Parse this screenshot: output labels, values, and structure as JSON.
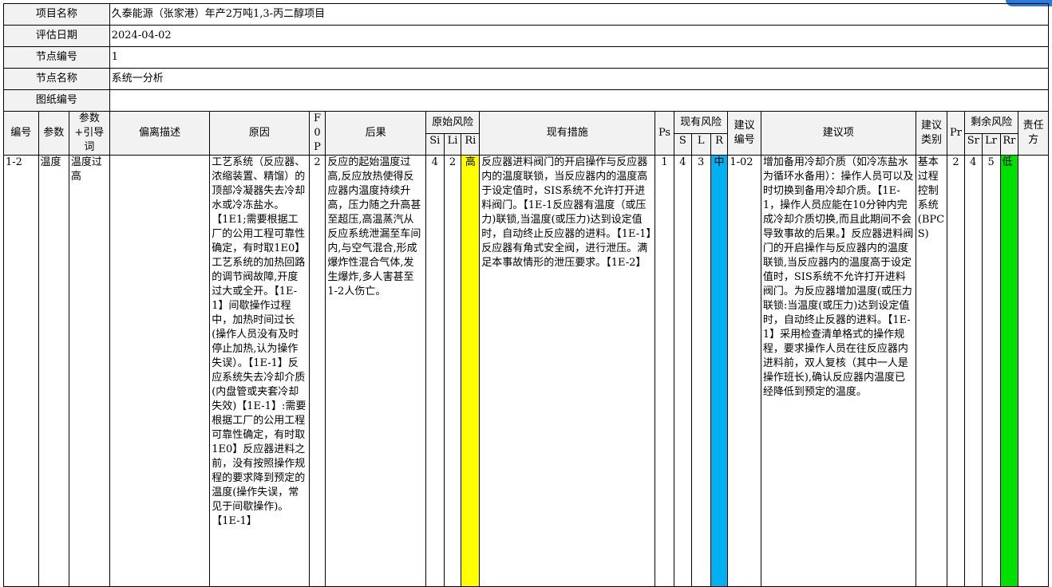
{
  "header": {
    "project_label": "项目名称",
    "project_value": "久泰能源（张家港）年产2万吨1,3-丙二醇项目",
    "date_label": "评估日期",
    "date_value": "2024-04-02",
    "node_no_label": "节点编号",
    "node_no_value": "1",
    "node_name_label": "节点名称",
    "node_name_value": "系统一分析",
    "drawing_label": "图纸编号",
    "drawing_value": ""
  },
  "columns": {
    "no": "编号",
    "param": "参数",
    "param_guide": "参数+引导词",
    "deviation": "偏离描述",
    "cause": "原因",
    "f0p": "F0P",
    "consequence": "后果",
    "orig_risk": "原始风险",
    "si": "Si",
    "li": "Li",
    "ri": "Ri",
    "measures": "现有措施",
    "ps": "Ps",
    "cur_risk": "现有风险",
    "s": "S",
    "l": "L",
    "r": "R",
    "sugg_no": "建议编号",
    "suggestion": "建议项",
    "sugg_type": "建议类别",
    "pr": "Pr",
    "rem_risk": "剩余风险",
    "sr": "Sr",
    "lr": "Lr",
    "rr": "Rr",
    "owner": "责任方"
  },
  "colors": {
    "high": "#ffff00",
    "medium": "#00b0f0",
    "low": "#00e000"
  },
  "row": {
    "no": "1-2",
    "param": "温度",
    "param_guide": "温度过高",
    "deviation": "",
    "cause": "工艺系统（反应器、浓缩装置、精馏）的顶部冷凝器失去冷却水或冷冻盐水。【1E1;需要根据工厂的公用工程可靠性确定，有时取1E0】工艺系统的加热回路的调节阀故障,开度过大或全开。【1E-1】间歇操作过程中，加热时间过长(操作人员没有及时停止加热,认为操作失误）。【1E-1】反应系统失去冷却介质(内盘管或夹套冷却失效)【1E-1】:需要根据工厂的公用工程可靠性确定，有时取1E0】反应器进料之前，没有按照操作规程的要求降到预定的温度(操作失误，常见于间歇操作)。【1E-1】",
    "f0p": "2",
    "consequence": "反应的起始温度过高,反应放热使得反应器内温度持续升高，压力随之升高甚至超压,高温蒸汽从反应系统泄漏至车间内,与空气混合,形成爆炸性混合气体,发生爆炸,多人害甚至1-2人伤亡。",
    "si": "4",
    "li": "2",
    "ri": "高",
    "measures": "反应器进料阀门的开启操作与反应器内的温度联锁，当反应器内的温度高于设定值时，SIS系统不允许打开进料阀门。【1E-1反应器有温度（或压力)联锁,当温度(或压力)达到设定值时，自动终止反应器的进料。【1E-1】反应器有角式安全阀，进行泄压。满足本事故情形的泄压要求。【1E-2】",
    "ps": "1",
    "s": "4",
    "l": "3",
    "r": "中",
    "sugg_no": "1-02",
    "suggestion": "增加备用冷却介质（如冷冻盐水为循环水备用）：操作人员可以及时切换到备用冷却介质。【1E-1，操作人员应能在10分钟内完成冷却介质切换,而且此期间不会导致事故的后果。】反应器进料阀门的开启操作与反应器内的温度联锁,当反应器内的温度高于设定值时，SIS系统不允许打开进料阀门。为反应器增加温度(或压力联锁:当温度(或压力)达到设定值时，自动终止反器的进料。【1E-1】采用检查清单格式的操作规程，要求操作人员在往反应器内进料前，双人复核（其中一人是操作班长),确认反应器内温度已经降低到预定的温度。",
    "sugg_type": "基本过程控制系统(BPCS)",
    "pr": "2",
    "sr": "4",
    "lr": "5",
    "rr": "低",
    "owner": ""
  }
}
